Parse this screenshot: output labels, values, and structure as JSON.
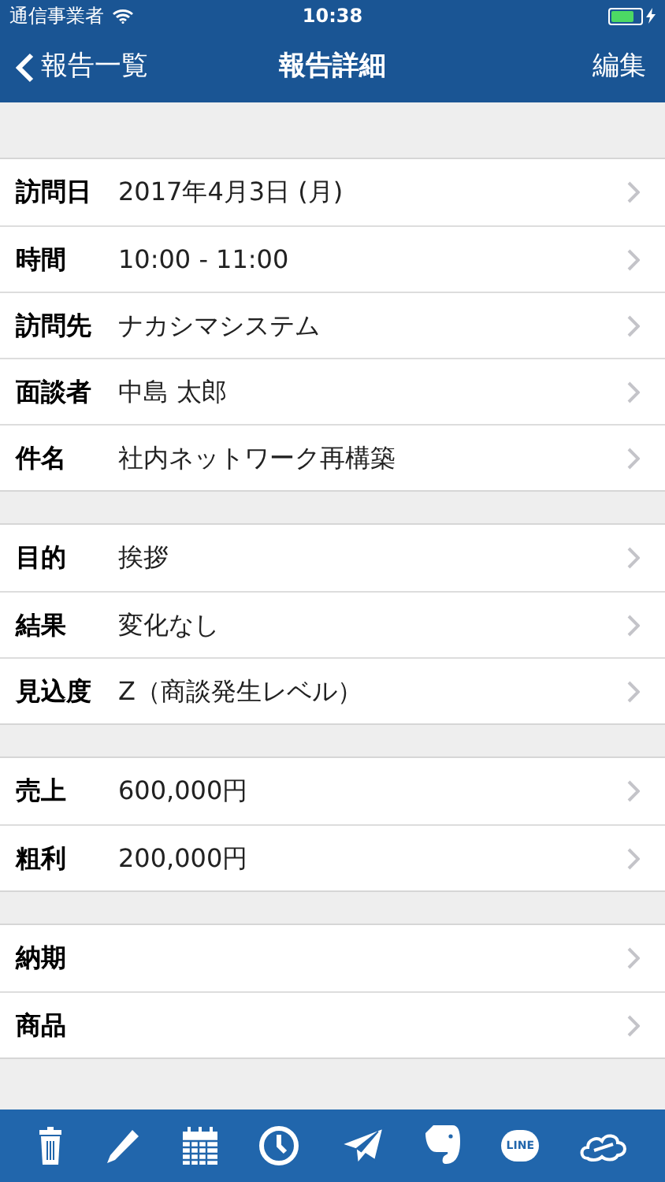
{
  "status_bar": {
    "carrier": "通信事業者",
    "time": "10:38",
    "battery": {
      "level": 0.8,
      "charging": true
    }
  },
  "nav": {
    "back": "報告一覧",
    "title": "報告詳細",
    "action": "編集"
  },
  "sections": [
    {
      "rows": [
        {
          "label": "訪問日",
          "value": "2017年4月3日 (月)"
        },
        {
          "label": "時間",
          "value": "10:00 - 11:00"
        },
        {
          "label": "訪問先",
          "value": "ナカシマシステム"
        },
        {
          "label": "面談者",
          "value": "中島 太郎"
        },
        {
          "label": "件名",
          "value": "社内ネットワーク再構築"
        }
      ]
    },
    {
      "rows": [
        {
          "label": "目的",
          "value": "挨拶"
        },
        {
          "label": "結果",
          "value": "変化なし"
        },
        {
          "label": "見込度",
          "value": "Z（商談発生レベル）"
        }
      ]
    },
    {
      "rows": [
        {
          "label": "売上",
          "value": "600,000円"
        },
        {
          "label": "粗利",
          "value": "200,000円"
        }
      ]
    },
    {
      "rows": [
        {
          "label": "納期"
        },
        {
          "label": "商品"
        }
      ]
    }
  ],
  "toolbar": [
    {
      "kind": "trash"
    },
    {
      "kind": "pencil"
    },
    {
      "kind": "calendar"
    },
    {
      "kind": "clock"
    },
    {
      "kind": "send"
    },
    {
      "kind": "elephant"
    },
    {
      "kind": "line",
      "text": "LINE"
    },
    {
      "kind": "cloud"
    }
  ]
}
